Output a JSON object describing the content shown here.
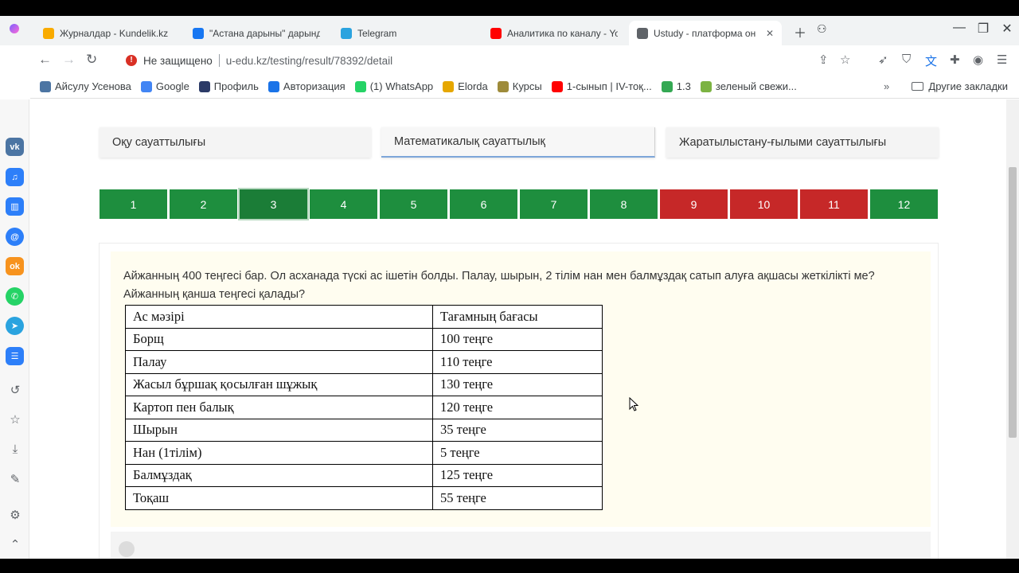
{
  "tabs": [
    {
      "label": "Журналдар - Kundelik.kz",
      "icon": "kundelik-icon",
      "color": "#f9ab00"
    },
    {
      "label": "\"Астана дарыны\" дарындыл",
      "icon": "facebook-icon",
      "color": "#1877f2"
    },
    {
      "label": "Telegram",
      "icon": "telegram-icon",
      "color": "#2aa3df"
    },
    {
      "label": "Аналитика по каналу - YouT",
      "icon": "youtube-icon",
      "color": "#ff0000"
    },
    {
      "label": "Ustudy - платформа онлайн",
      "icon": "ustudy-icon",
      "color": "#5f6368"
    }
  ],
  "address": {
    "security": "Не защищено",
    "url": "u-edu.kz/testing/result/78392/detail"
  },
  "bookmarks": [
    {
      "label": "Айсулу Усенова",
      "icon": "vk-icon",
      "color": "#4c75a3"
    },
    {
      "label": "Google",
      "icon": "google-icon",
      "color": "#4285f4"
    },
    {
      "label": "Профиль",
      "icon": "profile-icon",
      "color": "#2b3a67"
    },
    {
      "label": "Авторизация",
      "icon": "auth-icon",
      "color": "#1a73e8"
    },
    {
      "label": "(1) WhatsApp",
      "icon": "whatsapp-icon",
      "color": "#25d366"
    },
    {
      "label": "Elorda",
      "icon": "elorda-icon",
      "color": "#e6a700"
    },
    {
      "label": "Курсы",
      "icon": "courses-icon",
      "color": "#9e8b3a"
    },
    {
      "label": "1-сынып | IV-тоқ...",
      "icon": "youtube-icon",
      "color": "#ff0000"
    },
    {
      "label": "1.3",
      "icon": "sheet-icon",
      "color": "#34a853"
    },
    {
      "label": "зеленый свежи...",
      "icon": "leaf-icon",
      "color": "#7cb342"
    }
  ],
  "bookmarks_more": "Другие закладки",
  "categories": [
    "Оқу сауаттылығы",
    "Математикалық сауаттылық",
    "Жаратылыстану-ғылыми сауаттылығы"
  ],
  "questions": [
    {
      "n": "1",
      "status": "correct"
    },
    {
      "n": "2",
      "status": "correct"
    },
    {
      "n": "3",
      "status": "current"
    },
    {
      "n": "4",
      "status": "correct"
    },
    {
      "n": "5",
      "status": "correct"
    },
    {
      "n": "6",
      "status": "correct"
    },
    {
      "n": "7",
      "status": "correct"
    },
    {
      "n": "8",
      "status": "correct"
    },
    {
      "n": "9",
      "status": "wrong"
    },
    {
      "n": "10",
      "status": "wrong"
    },
    {
      "n": "11",
      "status": "wrong"
    },
    {
      "n": "12",
      "status": "correct"
    }
  ],
  "question": {
    "text_line1": "Айжанның 400 теңгесі бар. Ол асханада түскі ас ішетін болды. Палау, шырын, 2 тілім нан мен балмұздақ сатып алуға ақшасы жеткілікті ме?",
    "text_line2": "Айжанның қанша теңгесі қалады?",
    "table_header": [
      "Ас мәзірі",
      "Тағамның бағасы"
    ],
    "table_rows": [
      [
        "Борщ",
        "100 теңге"
      ],
      [
        "Палау",
        "110 теңге"
      ],
      [
        "Жасыл бұршақ қосылған шұжық",
        "130 теңге"
      ],
      [
        "Картоп пен балық",
        "120 теңге"
      ],
      [
        "Шырын",
        "35 теңге"
      ],
      [
        "Нан (1тілім)",
        "5 теңге"
      ],
      [
        "Балмұздақ",
        "125 теңге"
      ],
      [
        "Тоқаш",
        "55 теңге"
      ]
    ]
  },
  "colors": {
    "correct": "#1e8e3e",
    "wrong": "#c62828",
    "current": "#1b7d37"
  }
}
